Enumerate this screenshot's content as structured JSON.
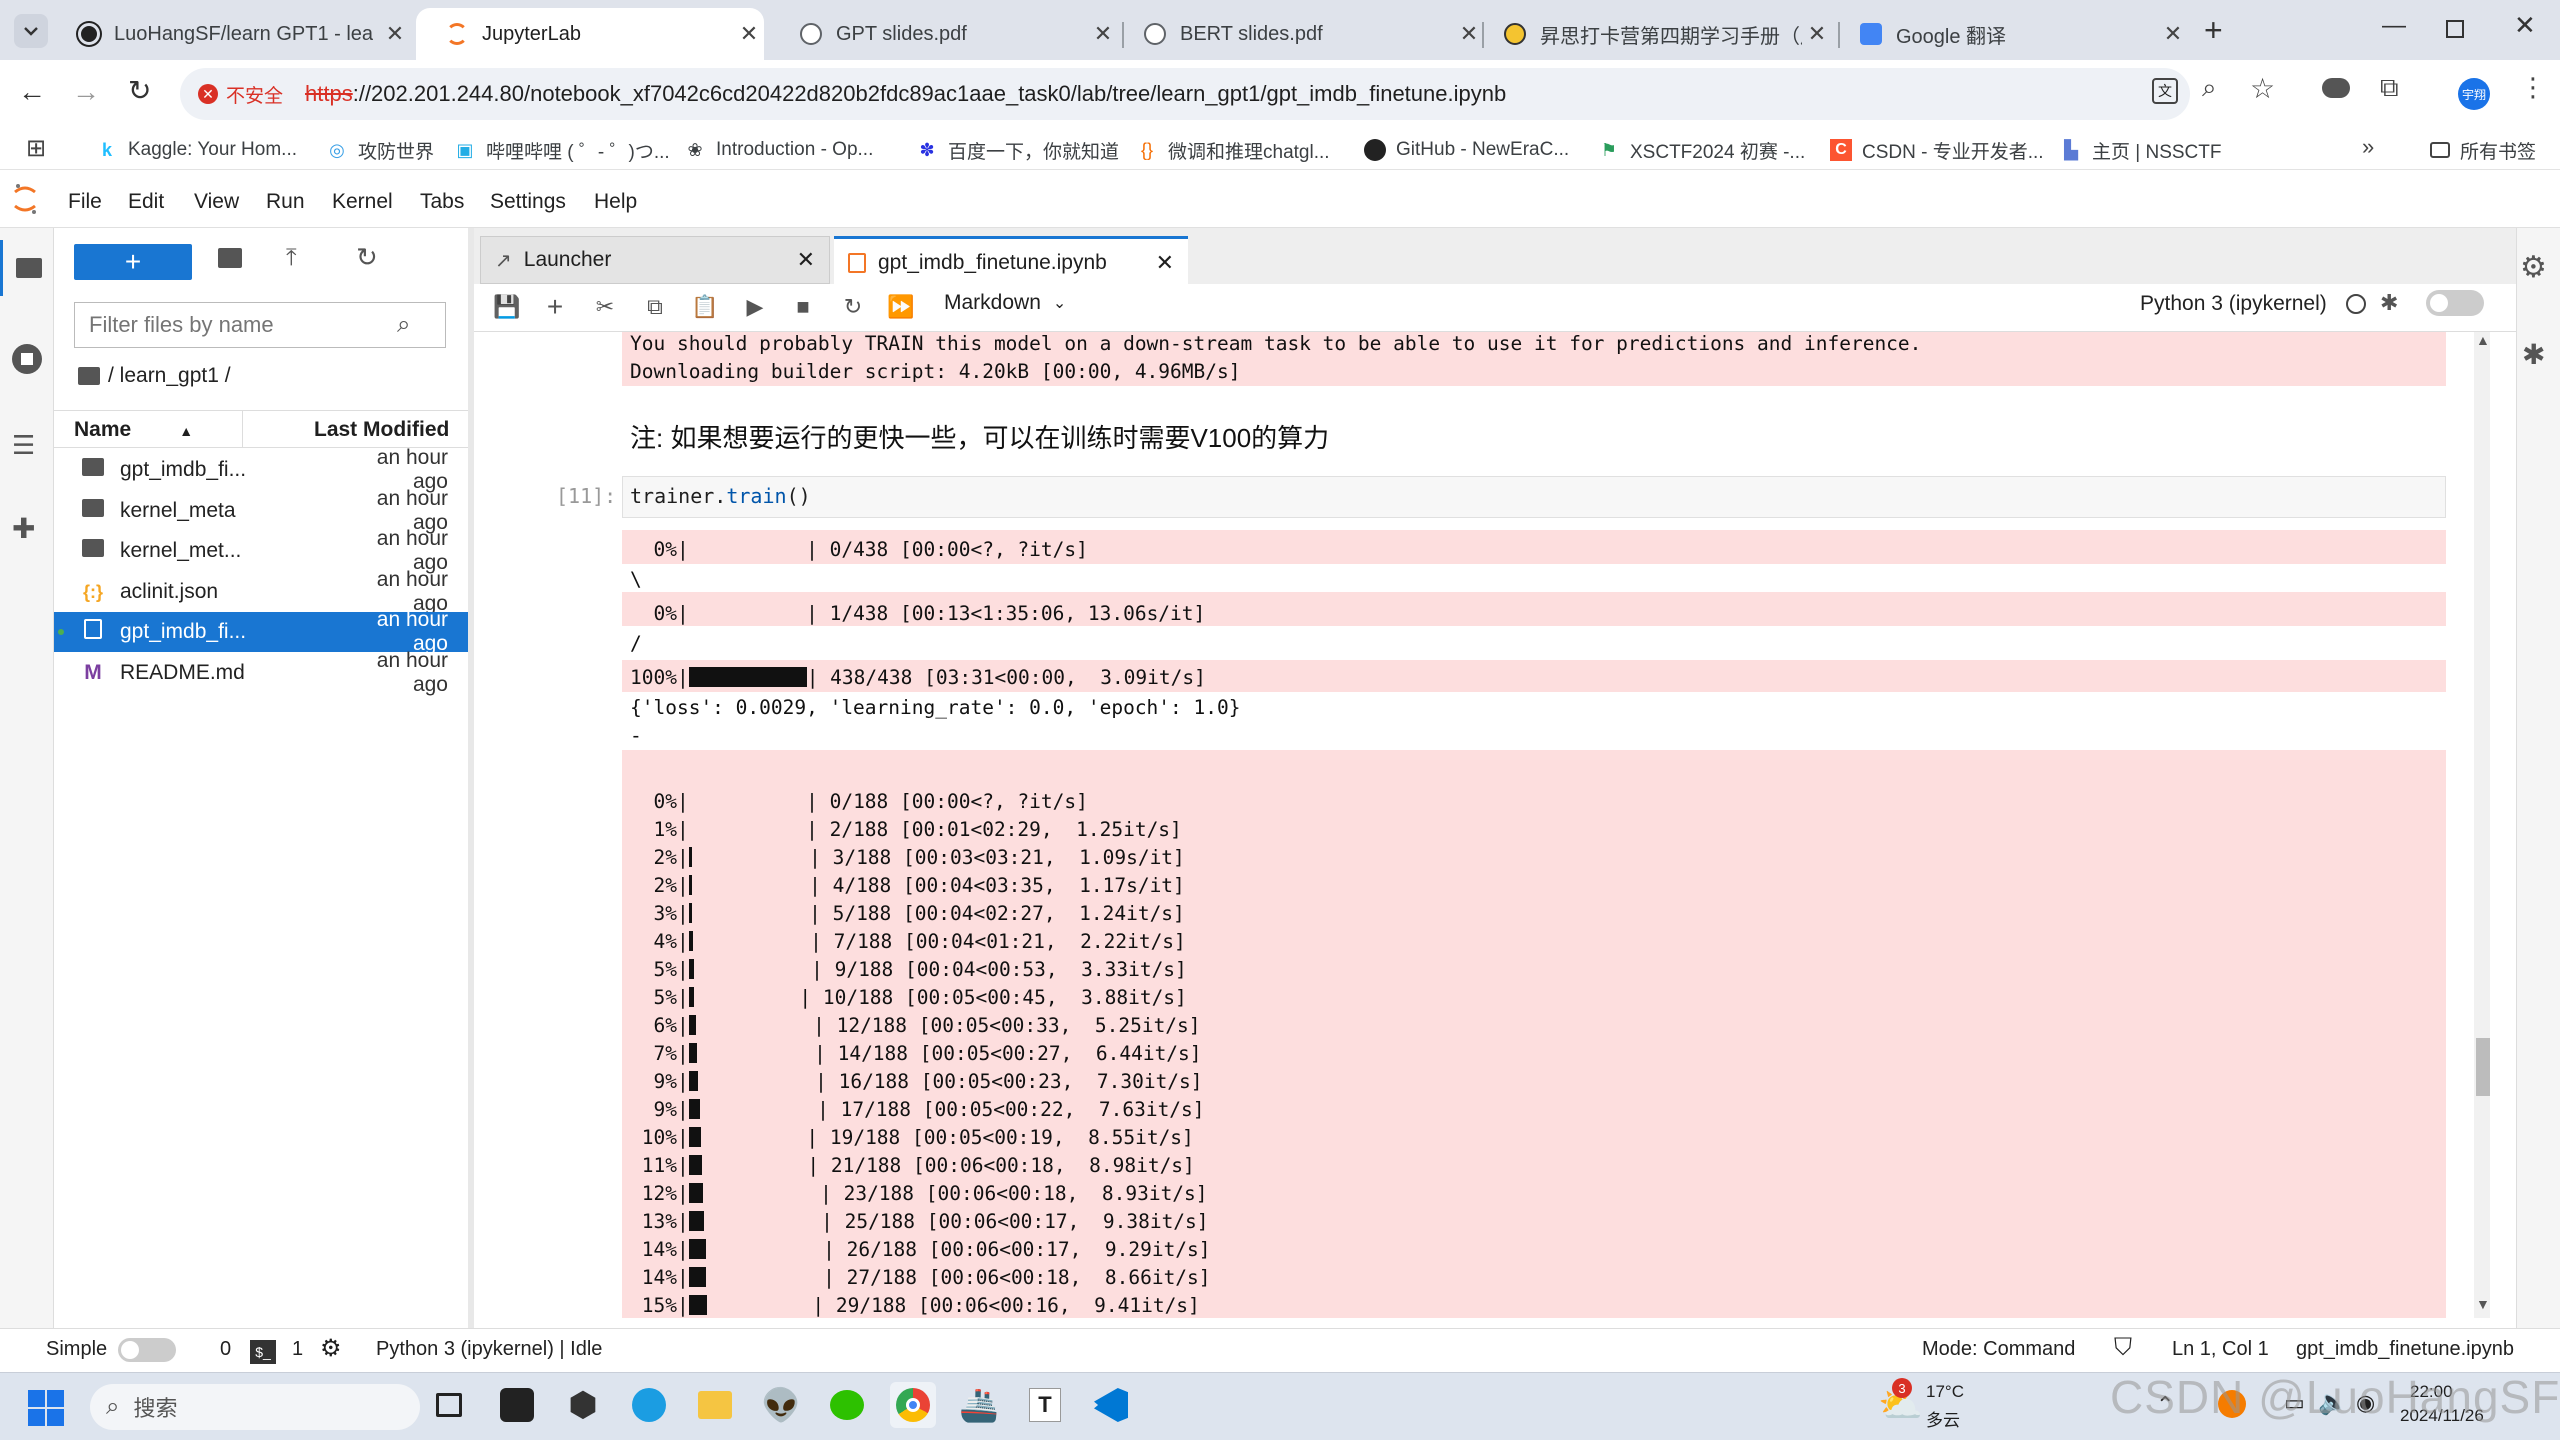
{
  "browser": {
    "tabs": [
      {
        "title": "LuoHangSF/learn GPT1 - lea",
        "active": false
      },
      {
        "title": "JupyterLab",
        "active": true
      },
      {
        "title": "GPT slides.pdf",
        "active": false
      },
      {
        "title": "BERT slides.pdf",
        "active": false
      },
      {
        "title": "昇思打卡营第四期学习手册（启",
        "active": false
      },
      {
        "title": "Google 翻译",
        "active": false
      }
    ],
    "insecure_label": "不安全",
    "url_scheme": "https",
    "url_rest": "://202.201.244.80/notebook_xf7042c6cd20422d820b2fdc89ac1aae_task0/lab/tree/learn_gpt1/gpt_imdb_finetune.ipynb",
    "profile_label": "宇翔",
    "bookmarks": [
      {
        "label": "Kaggle: Your Hom...",
        "icon": "k"
      },
      {
        "label": "攻防世界",
        "icon": "swirl"
      },
      {
        "label": "哔哩哔哩 ( ゜- ゜)つ...",
        "icon": "tv"
      },
      {
        "label": "Introduction - Op...",
        "icon": "openai"
      },
      {
        "label": "百度一下，你就知道",
        "icon": "paw"
      },
      {
        "label": "微调和推理chatgl...",
        "icon": "bracket"
      },
      {
        "label": "GitHub - NewEraC...",
        "icon": "github"
      },
      {
        "label": "XSCTF2024 初赛 -...",
        "icon": "flag"
      },
      {
        "label": "CSDN - 专业开发者...",
        "icon": "C"
      },
      {
        "label": "主页 | NSSCTF",
        "icon": "ns"
      }
    ],
    "all_bookmarks": "所有书签"
  },
  "jupyter": {
    "menu": [
      "File",
      "Edit",
      "View",
      "Run",
      "Kernel",
      "Tabs",
      "Settings",
      "Help"
    ],
    "filter_placeholder": "Filter files by name",
    "breadcrumb": "/ learn_gpt1 /",
    "col_name": "Name",
    "col_modified": "Last Modified",
    "files": [
      {
        "name": "gpt_imdb_fi...",
        "modified": "an hour ago",
        "type": "folder",
        "selected": false
      },
      {
        "name": "kernel_meta",
        "modified": "an hour ago",
        "type": "folder",
        "selected": false
      },
      {
        "name": "kernel_met...",
        "modified": "an hour ago",
        "type": "folder",
        "selected": false
      },
      {
        "name": "aclinit.json",
        "modified": "an hour ago",
        "type": "json",
        "selected": false
      },
      {
        "name": "gpt_imdb_fi...",
        "modified": "an hour ago",
        "type": "notebook",
        "selected": true
      },
      {
        "name": "README.md",
        "modified": "an hour ago",
        "type": "markdown",
        "selected": false
      }
    ],
    "doc_tabs": [
      {
        "title": "Launcher",
        "active": false
      },
      {
        "title": "gpt_imdb_finetune.ipynb",
        "active": true
      }
    ],
    "cell_type": "Markdown",
    "kernel_name": "Python 3 (ipykernel)",
    "notebook": {
      "top_output": [
        "You should probably TRAIN this model on a down-stream task to be able to use it for predictions and inference.",
        "Downloading builder script: 4.20kB [00:00, 4.96MB/s]"
      ],
      "markdown_text": "注: 如果想要运行的更快一些，可以在训练时需要V100的算力",
      "cell_prompt": "[11]:",
      "code_obj": "trainer",
      "code_method": "train",
      "code_tail": "()",
      "train_progress": [
        {
          "pct": "  0%|",
          "fill": 0,
          "rest": "          | 0/438 [00:00<?, ?it/s]"
        },
        {
          "sep": "\\"
        },
        {
          "pct": "  0%|",
          "fill": 0,
          "rest": "          | 1/438 [00:13<1:35:06, 13.06s/it]"
        },
        {
          "sep": "/"
        },
        {
          "pct": "100%|",
          "fill": 1,
          "rest": "| 438/438 [03:31<00:00,  3.09it/s]"
        }
      ],
      "loss_line": "{'loss': 0.0029, 'learning_rate': 0.0, 'epoch': 1.0}",
      "dash_line": "-",
      "eval_progress": [
        {
          "pct": "  0%|",
          "fill": 0,
          "rest": "          | 0/188 [00:00<?, ?it/s]"
        },
        {
          "pct": "  1%|",
          "fill": 0,
          "rest": "          | 2/188 [00:01<02:29,  1.25it/s]"
        },
        {
          "pct": "  2%|",
          "fill": 0.015,
          "rest": "          | 3/188 [00:03<03:21,  1.09s/it]"
        },
        {
          "pct": "  2%|",
          "fill": 0.015,
          "rest": "          | 4/188 [00:04<03:35,  1.17s/it]"
        },
        {
          "pct": "  3%|",
          "fill": 0.02,
          "rest": "          | 5/188 [00:04<02:27,  1.24it/s]"
        },
        {
          "pct": "  4%|",
          "fill": 0.03,
          "rest": "          | 7/188 [00:04<01:21,  2.22it/s]"
        },
        {
          "pct": "  5%|",
          "fill": 0.04,
          "rest": "          | 9/188 [00:04<00:53,  3.33it/s]"
        },
        {
          "pct": "  5%|",
          "fill": 0.045,
          "rest": "         | 10/188 [00:05<00:45,  3.88it/s]"
        },
        {
          "pct": "  6%|",
          "fill": 0.06,
          "rest": "          | 12/188 [00:05<00:33,  5.25it/s]"
        },
        {
          "pct": "  7%|",
          "fill": 0.07,
          "rest": "          | 14/188 [00:05<00:27,  6.44it/s]"
        },
        {
          "pct": "  9%|",
          "fill": 0.08,
          "rest": "          | 16/188 [00:05<00:23,  7.30it/s]"
        },
        {
          "pct": "  9%|",
          "fill": 0.09,
          "rest": "          | 17/188 [00:05<00:22,  7.63it/s]"
        },
        {
          "pct": " 10%|",
          "fill": 0.1,
          "rest": "         | 19/188 [00:05<00:19,  8.55it/s]"
        },
        {
          "pct": " 11%|",
          "fill": 0.11,
          "rest": "         | 21/188 [00:06<00:18,  8.98it/s]"
        },
        {
          "pct": " 12%|",
          "fill": 0.12,
          "rest": "          | 23/188 [00:06<00:18,  8.93it/s]"
        },
        {
          "pct": " 13%|",
          "fill": 0.13,
          "rest": "          | 25/188 [00:06<00:17,  9.38it/s]"
        },
        {
          "pct": " 14%|",
          "fill": 0.14,
          "rest": "          | 26/188 [00:06<00:17,  9.29it/s]"
        },
        {
          "pct": " 14%|",
          "fill": 0.14,
          "rest": "          | 27/188 [00:06<00:18,  8.66it/s]"
        },
        {
          "pct": " 15%|",
          "fill": 0.15,
          "rest": "         | 29/188 [00:06<00:16,  9.41it/s]"
        }
      ]
    },
    "status": {
      "mode_label": "Simple",
      "terminals": "0",
      "kernels": "1",
      "kernel_status": "Python 3 (ipykernel) | Idle",
      "mode": "Mode: Command",
      "cursor": "Ln 1, Col 1",
      "file": "gpt_imdb_finetune.ipynb"
    }
  },
  "taskbar": {
    "search_placeholder": "搜索",
    "weather_temp": "17°C",
    "weather_desc": "多云",
    "weather_badge": "3",
    "time": "22:00",
    "date": "2024/11/26",
    "watermark": "CSDN @LuoHangSF"
  },
  "colors": {
    "accent": "#1976d2",
    "jupyter_orange": "#f37626",
    "stderr_bg": "#fddede",
    "tab_bg": "#dfe3eb"
  }
}
